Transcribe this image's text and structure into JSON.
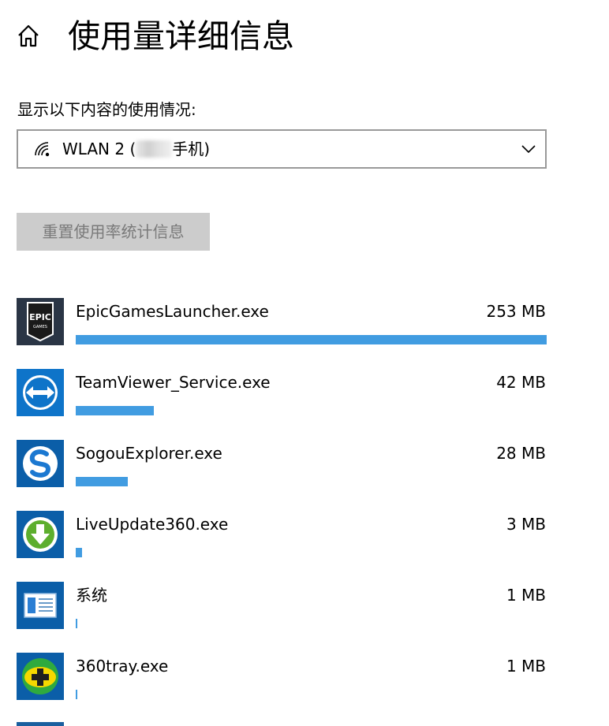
{
  "header": {
    "title": "使用量详细信息",
    "home_icon": "home-icon"
  },
  "filter": {
    "label": "显示以下内容的使用情况:",
    "selected_network_prefix": "WLAN 2 (",
    "selected_network_suffix": "手机)",
    "icons": [
      "wifi-icon",
      "chevron-down-icon"
    ]
  },
  "reset_button": {
    "label": "重置使用率统计信息"
  },
  "colors": {
    "accent": "#419ce1",
    "button_bg": "#cccccc",
    "button_text": "#7a7a7a",
    "border": "#999999"
  },
  "apps": [
    {
      "name": "EpicGamesLauncher.exe",
      "usage": "253 MB",
      "fraction": 1.0,
      "icon": "epic-games-icon"
    },
    {
      "name": "TeamViewer_Service.exe",
      "usage": "42 MB",
      "fraction": 0.166,
      "icon": "teamviewer-icon"
    },
    {
      "name": "SogouExplorer.exe",
      "usage": "28 MB",
      "fraction": 0.111,
      "icon": "sogou-explorer-icon"
    },
    {
      "name": "LiveUpdate360.exe",
      "usage": "3 MB",
      "fraction": 0.0134,
      "icon": "liveupdate360-icon"
    },
    {
      "name": "系统",
      "usage": "1 MB",
      "fraction": 0.004,
      "icon": "system-icon"
    },
    {
      "name": "360tray.exe",
      "usage": "1 MB",
      "fraction": 0.004,
      "icon": "360-tray-icon"
    }
  ]
}
